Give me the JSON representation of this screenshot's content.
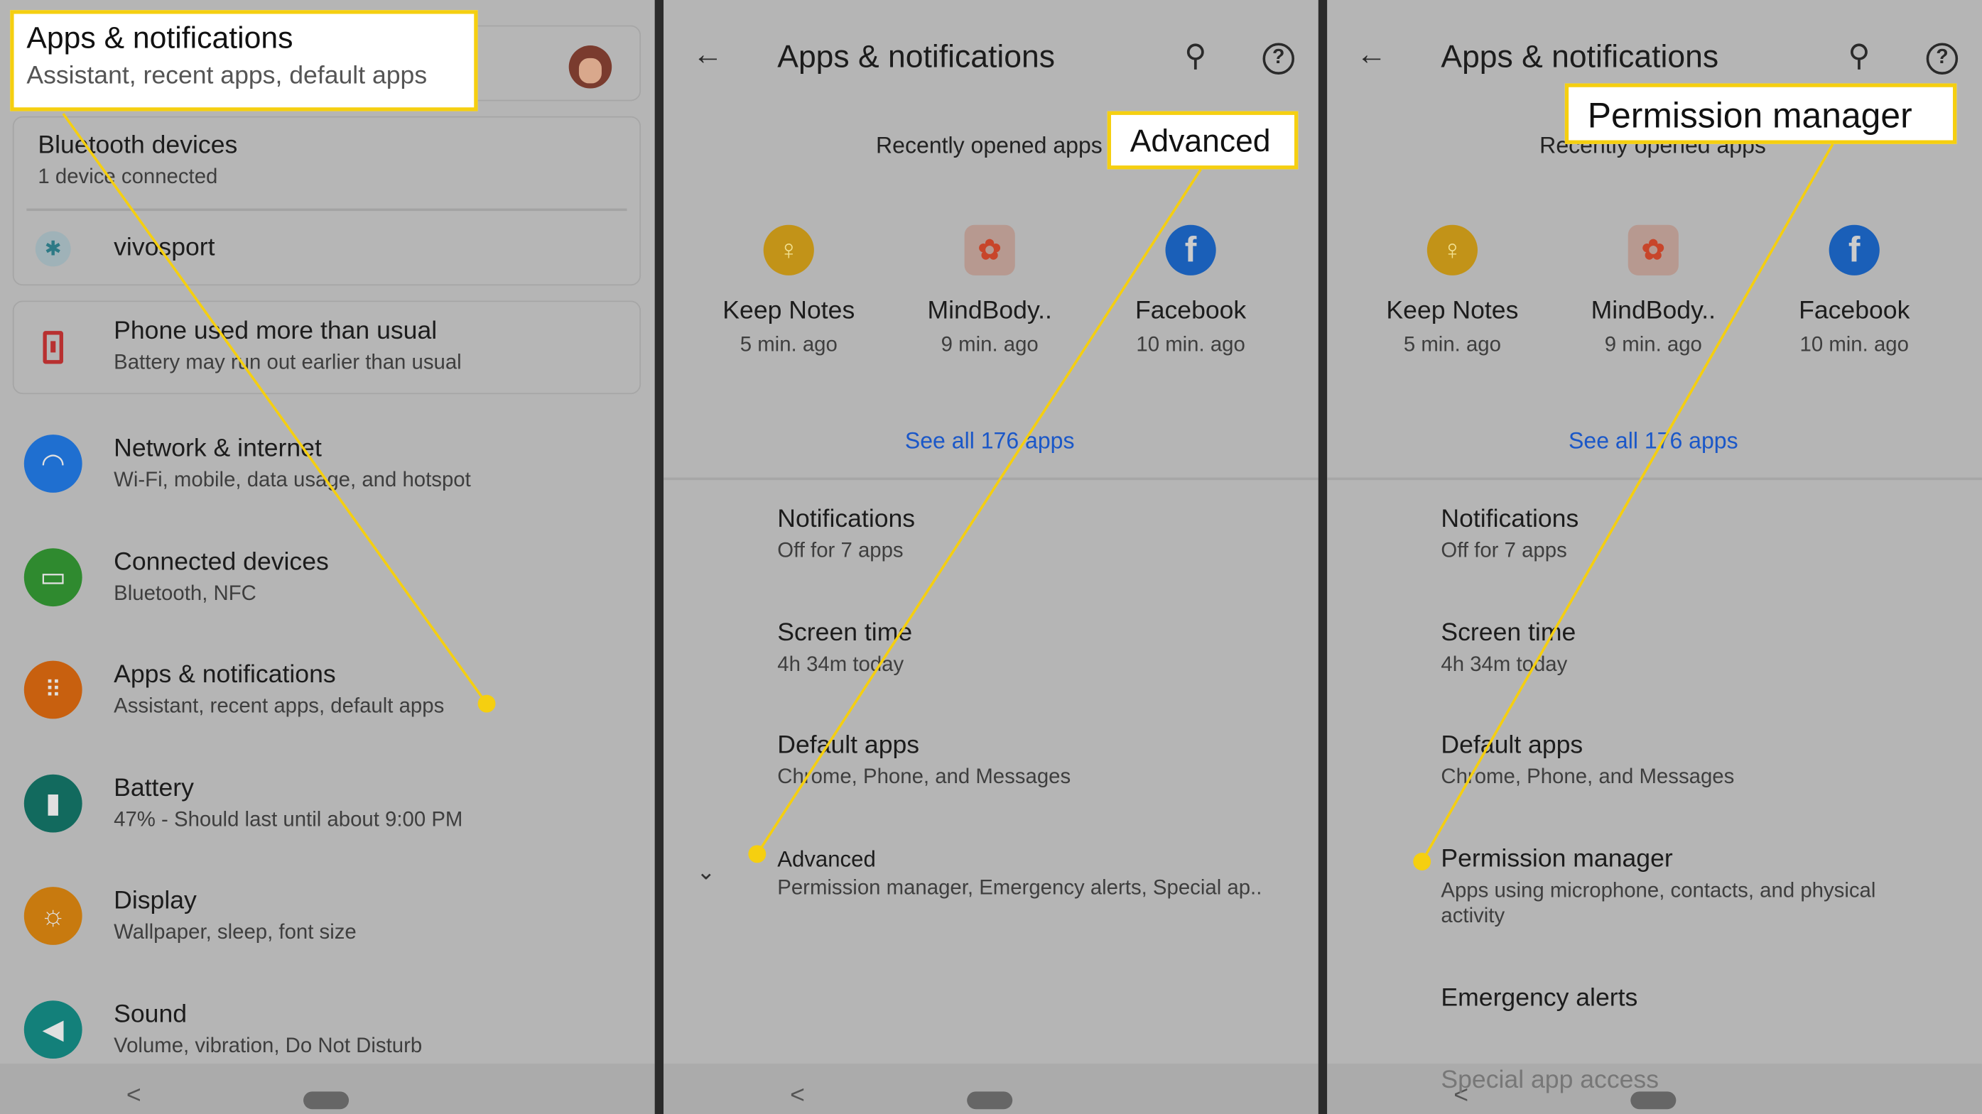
{
  "colors": {
    "highlight": "#f5cf10",
    "link": "#1a57c8",
    "background": "#b5b5b5"
  },
  "panel1": {
    "callout": {
      "title": "Apps & notifications",
      "subtitle": "Assistant, recent apps, default apps"
    },
    "bluetooth": {
      "title": "Bluetooth devices",
      "subtitle": "1 device connected",
      "device": "vivosport",
      "icon": "bluetooth-icon"
    },
    "suggestion": {
      "title": "Phone used more than usual",
      "subtitle": "Battery may run out earlier than usual",
      "icon": "battery-alert-icon"
    },
    "items": [
      {
        "title": "Network & internet",
        "subtitle": "Wi-Fi, mobile, data usage, and hotspot",
        "icon": "wifi-icon",
        "color": "#1f6fd0"
      },
      {
        "title": "Connected devices",
        "subtitle": "Bluetooth, NFC",
        "icon": "devices-icon",
        "color": "#2f8a2f"
      },
      {
        "title": "Apps & notifications",
        "subtitle": "Assistant, recent apps, default apps",
        "icon": "apps-grid-icon",
        "color": "#c8600f"
      },
      {
        "title": "Battery",
        "subtitle": "47% - Should last until about 9:00 PM",
        "icon": "battery-icon",
        "color": "#126a5e"
      },
      {
        "title": "Display",
        "subtitle": "Wallpaper, sleep, font size",
        "icon": "brightness-icon",
        "color": "#c87a0f"
      },
      {
        "title": "Sound",
        "subtitle": "Volume, vibration, Do Not Disturb",
        "icon": "volume-icon",
        "color": "#13807a"
      }
    ]
  },
  "panel2": {
    "title": "Apps & notifications",
    "callout": "Advanced",
    "recent_label": "Recently opened apps",
    "apps": [
      {
        "name": "Keep Notes",
        "time": "5 min. ago",
        "icon": "keep-notes-icon"
      },
      {
        "name": "MindBody..",
        "time": "9 min. ago",
        "icon": "mindbody-icon"
      },
      {
        "name": "Facebook",
        "time": "10 min. ago",
        "icon": "facebook-icon"
      }
    ],
    "see_all": "See all 176 apps",
    "list": [
      {
        "title": "Notifications",
        "subtitle": "Off for 7 apps"
      },
      {
        "title": "Screen time",
        "subtitle": "4h 34m today"
      },
      {
        "title": "Default apps",
        "subtitle": "Chrome, Phone, and Messages"
      },
      {
        "title": "Advanced",
        "subtitle": "Permission manager, Emergency alerts, Special ap.."
      }
    ]
  },
  "panel3": {
    "title": "Apps & notifications",
    "callout": "Permission manager",
    "recent_label": "Recently opened apps",
    "apps": [
      {
        "name": "Keep Notes",
        "time": "5 min. ago"
      },
      {
        "name": "MindBody..",
        "time": "9 min. ago"
      },
      {
        "name": "Facebook",
        "time": "10 min. ago"
      }
    ],
    "see_all": "See all 176 apps",
    "list": [
      {
        "title": "Notifications",
        "subtitle": "Off for 7 apps"
      },
      {
        "title": "Screen time",
        "subtitle": "4h 34m today"
      },
      {
        "title": "Default apps",
        "subtitle": "Chrome, Phone, and Messages"
      },
      {
        "title": "Permission manager",
        "subtitle": "Apps using microphone, contacts, and physical",
        "subtitle2": "activity"
      },
      {
        "title": "Emergency alerts"
      },
      {
        "title": "Special app access"
      }
    ]
  },
  "nav": {
    "back": "<"
  }
}
